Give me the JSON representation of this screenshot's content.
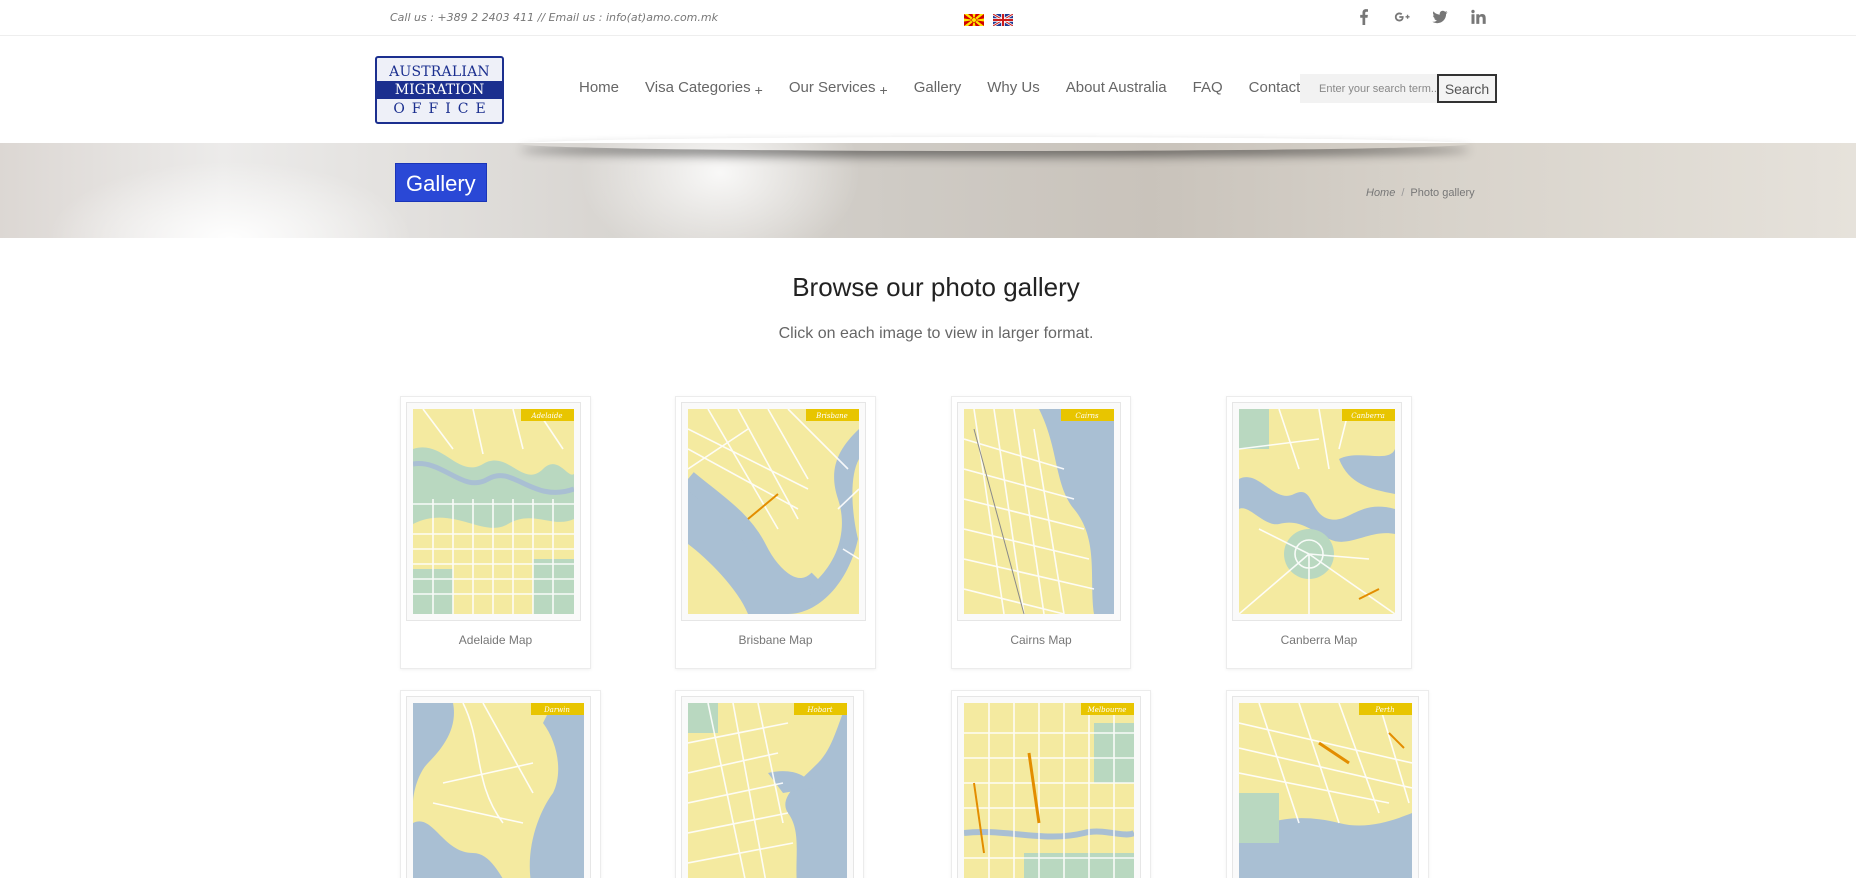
{
  "topbar": {
    "contact": "Call us : +389 2 2403 411 // Email us : info(at)amo.com.mk",
    "flags": [
      "mk-flag-icon",
      "uk-flag-icon"
    ],
    "social": [
      "facebook-icon",
      "google-plus-icon",
      "twitter-icon",
      "linkedin-icon"
    ]
  },
  "logo": {
    "line1": "AUSTRALIAN",
    "line2": "MIGRATION",
    "line3": "OFFICE"
  },
  "nav": {
    "items": [
      {
        "label": "Home",
        "has_submenu": false
      },
      {
        "label": "Visa Categories",
        "has_submenu": true
      },
      {
        "label": "Our Services",
        "has_submenu": true
      },
      {
        "label": "Gallery",
        "has_submenu": false
      },
      {
        "label": "Why Us",
        "has_submenu": false
      },
      {
        "label": "About Australia",
        "has_submenu": false
      },
      {
        "label": "FAQ",
        "has_submenu": false
      },
      {
        "label": "Contact Us",
        "has_submenu": false
      }
    ],
    "submenu_marker": "+"
  },
  "search": {
    "placeholder": "Enter your search term...",
    "button_label": "Search"
  },
  "banner": {
    "title": "Gallery",
    "breadcrumb_home": "Home",
    "breadcrumb_sep": "/",
    "breadcrumb_current": "Photo gallery"
  },
  "content": {
    "heading": "Browse our photo gallery",
    "subheading": "Click on each image to view in larger format."
  },
  "gallery": {
    "items": [
      {
        "caption": "Adelaide Map",
        "tag": "Adelaide"
      },
      {
        "caption": "Brisbane Map",
        "tag": "Brisbane"
      },
      {
        "caption": "Cairns Map",
        "tag": "Cairns"
      },
      {
        "caption": "Canberra Map",
        "tag": "Canberra"
      },
      {
        "caption": "",
        "tag": "Darwin"
      },
      {
        "caption": "",
        "tag": "Hobart"
      },
      {
        "caption": "",
        "tag": "Melbourne"
      },
      {
        "caption": "",
        "tag": "Perth"
      }
    ]
  },
  "colors": {
    "accent_blue": "#2a48d6",
    "logo_navy": "#1b2f8f",
    "map_land": "#f4eaa0",
    "map_water": "#a9bfd3",
    "map_park": "#b9d8c0",
    "map_tag": "#e8c500"
  }
}
